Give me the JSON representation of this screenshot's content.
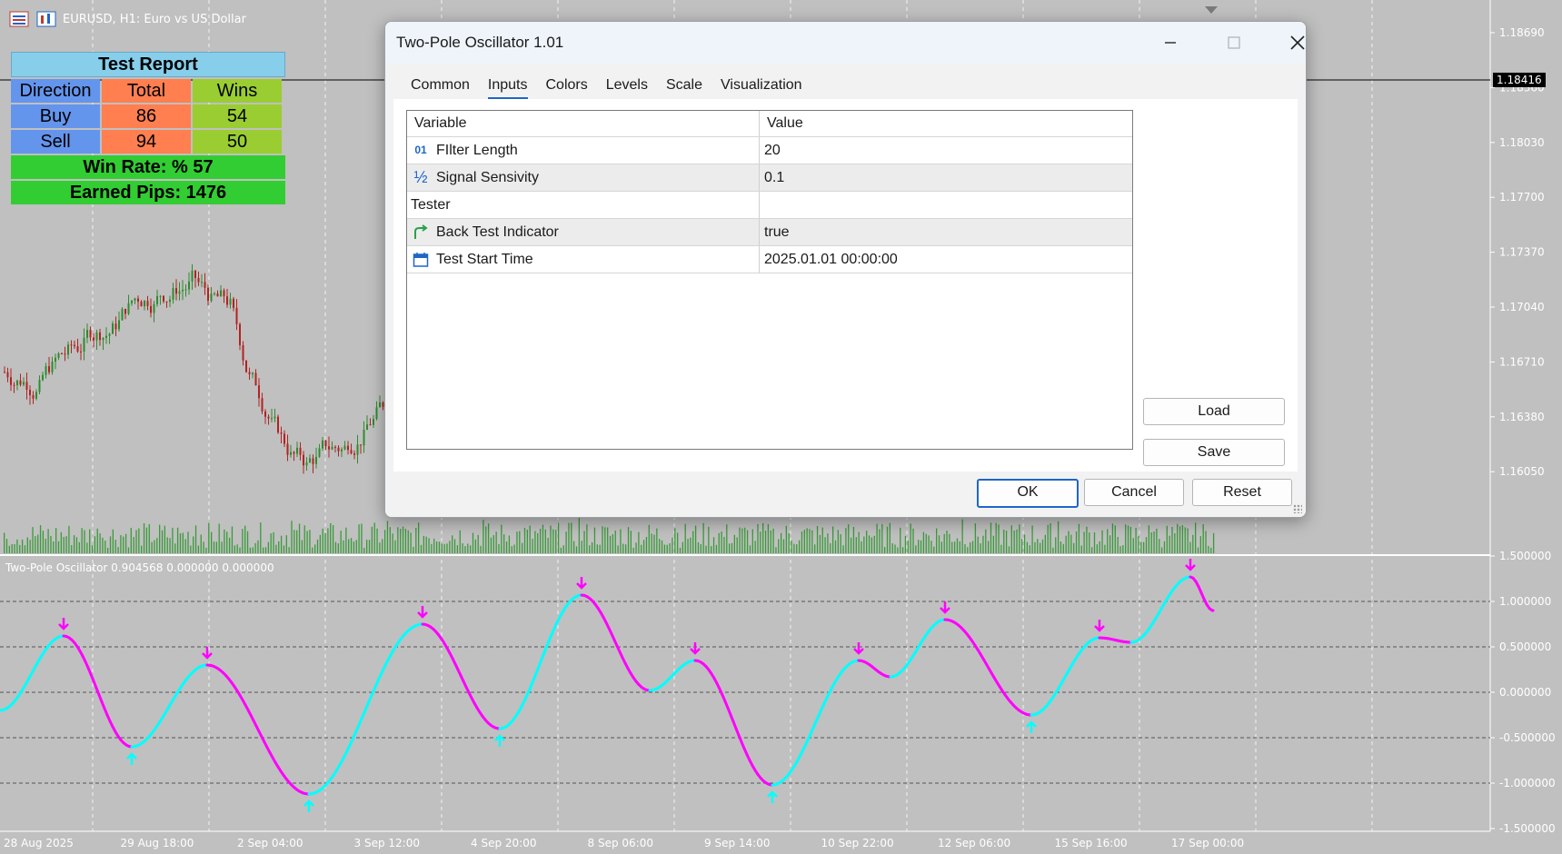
{
  "chart": {
    "title": "EURUSD, H1:  Euro vs US Dollar",
    "price_levels": [
      "1.18690",
      "1.18360",
      "1.18030",
      "1.17700",
      "1.17370",
      "1.17040",
      "1.16710",
      "1.16380",
      "1.16050"
    ],
    "current_price": "1.18416",
    "osc_levels": [
      "1.500000",
      "1.000000",
      "0.500000",
      "0.000000",
      "-0.500000",
      "-1.000000",
      "-1.500000"
    ],
    "time_labels": [
      "28 Aug 2025",
      "29 Aug 18:00",
      "2 Sep 04:00",
      "3 Sep 12:00",
      "4 Sep 20:00",
      "8 Sep 06:00",
      "9 Sep 14:00",
      "10 Sep 22:00",
      "12 Sep 06:00",
      "15 Sep 16:00",
      "17 Sep 00:00"
    ],
    "oscillator_title": "Two-Pole Oscillator 0.904568 0.000000 0.000000",
    "colors": {
      "background": "#c0c0c0",
      "bull": "#2e8b2e",
      "bear": "#b22222",
      "osc_up": "#00ffff",
      "osc_down": "#ff00ff",
      "volume": "#3a9a3a"
    }
  },
  "report": {
    "title": "Test Report",
    "headers": [
      "Direction",
      "Total",
      "Wins"
    ],
    "rows": [
      {
        "direction": "Buy",
        "total": "86",
        "wins": "54"
      },
      {
        "direction": "Sell",
        "total": "94",
        "wins": "50"
      }
    ],
    "win_rate": "Win Rate: %  57",
    "earned": "Earned Pips: 1476"
  },
  "dialog": {
    "title": "Two-Pole Oscillator 1.01",
    "tabs": [
      "Common",
      "Inputs",
      "Colors",
      "Levels",
      "Scale",
      "Visualization"
    ],
    "active_tab": "Inputs",
    "columns": [
      "Variable",
      "Value"
    ],
    "rows": [
      {
        "icon": "integer-icon",
        "glyph": "01",
        "variable": "FIlter Length",
        "value": "20"
      },
      {
        "icon": "fraction-icon",
        "glyph": "½",
        "variable": "Signal Sensivity",
        "value": "0.1"
      },
      {
        "icon": "",
        "glyph": "",
        "variable": "Tester",
        "value": ""
      },
      {
        "icon": "boolean-icon",
        "glyph": "↱",
        "variable": "Back Test Indicator",
        "value": "true"
      },
      {
        "icon": "calendar-icon",
        "glyph": "",
        "variable": "Test Start Time",
        "value": "2025.01.01 00:00:00"
      }
    ],
    "load": "Load",
    "save": "Save",
    "ok": "OK",
    "cancel": "Cancel",
    "reset": "Reset"
  }
}
